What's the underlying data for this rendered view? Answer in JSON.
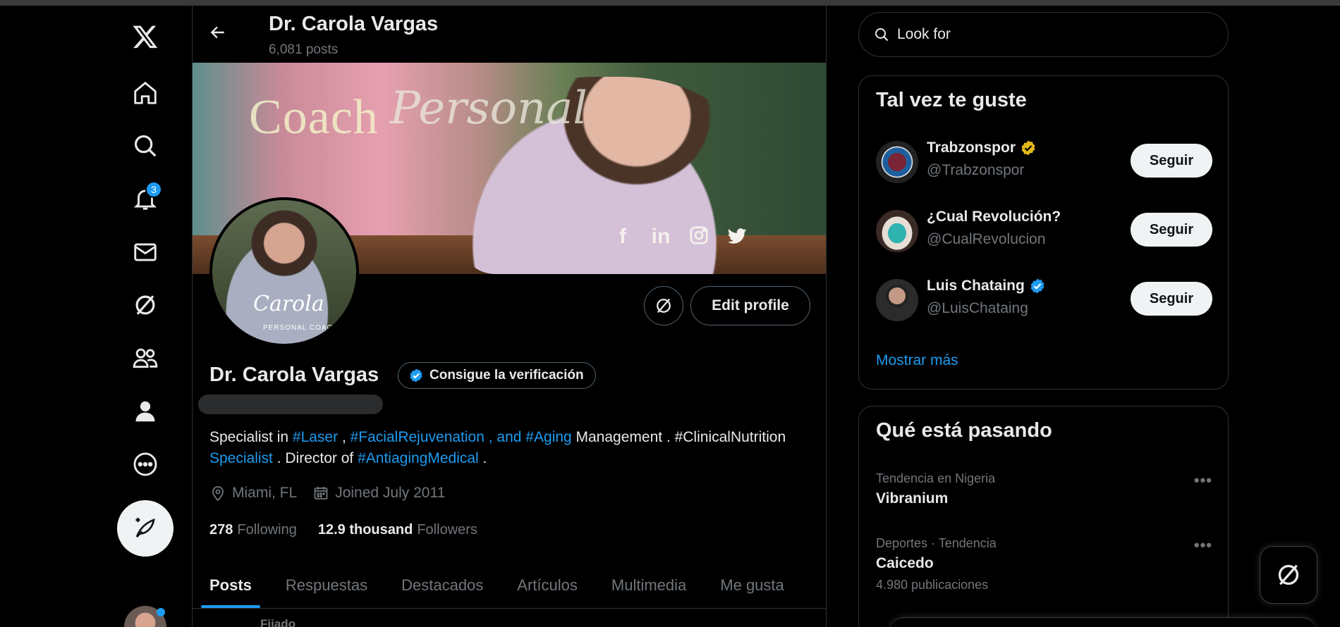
{
  "nav": {
    "notification_count": "3"
  },
  "header": {
    "name": "Dr. Carola Vargas",
    "post_count": "6,081 posts"
  },
  "banner": {
    "coach_text": "Coach",
    "personal_text": "Personal",
    "social_icons": [
      "facebook-icon",
      "linkedin-icon",
      "instagram-icon",
      "twitter-bird-icon"
    ]
  },
  "avatar": {
    "signature": "Carola",
    "sub": "PERSONAL COACH"
  },
  "profile": {
    "name": "Dr. Carola Vargas",
    "verify_label": "Consigue la verificación",
    "edit_label": "Edit profile",
    "bio": {
      "t1": "Specialist in ",
      "l1": "#Laser",
      "t2": " , ",
      "l2": "#FacialRejuvenation , and #Aging",
      "t3": " Management . #ClinicalNutrition ",
      "l3": "Specialist",
      "t4": " . Director of ",
      "l4": "#AntiagingMedical",
      "t5": " ."
    },
    "location": "Miami, FL",
    "joined": "Joined July 2011",
    "following_count": "278",
    "following_label": "Following",
    "followers_count": "12.9 thousand",
    "followers_label": "Followers"
  },
  "tabs": [
    "Posts",
    "Respuestas",
    "Destacados",
    "Artículos",
    "Multimedia",
    "Me gusta"
  ],
  "pinned_label": "Fijado",
  "search": {
    "placeholder": "Look for"
  },
  "suggestions": {
    "title": "Tal vez te guste",
    "follow_label": "Seguir",
    "items": [
      {
        "name": "Trabzonspor",
        "handle": "@Trabzonspor",
        "badge_color": "#e2b719"
      },
      {
        "name": "¿Cual Revolución?",
        "handle": "@CualRevolucion"
      },
      {
        "name": "Luis Chataing",
        "handle": "@LuisChataing",
        "badge_color": "#1d9bf0"
      }
    ],
    "more": "Mostrar más"
  },
  "trends": {
    "title": "Qué está pasando",
    "items": [
      {
        "category": "Tendencia en Nigeria",
        "name": "Vibranium",
        "count": ""
      },
      {
        "category": "Deportes · Tendencia",
        "name": "Caicedo",
        "count": "4.980 publicaciones"
      }
    ]
  },
  "colors": {
    "accent": "#1d9bf0",
    "background": "#000000",
    "border": "#2f3336",
    "muted": "#71767b"
  }
}
